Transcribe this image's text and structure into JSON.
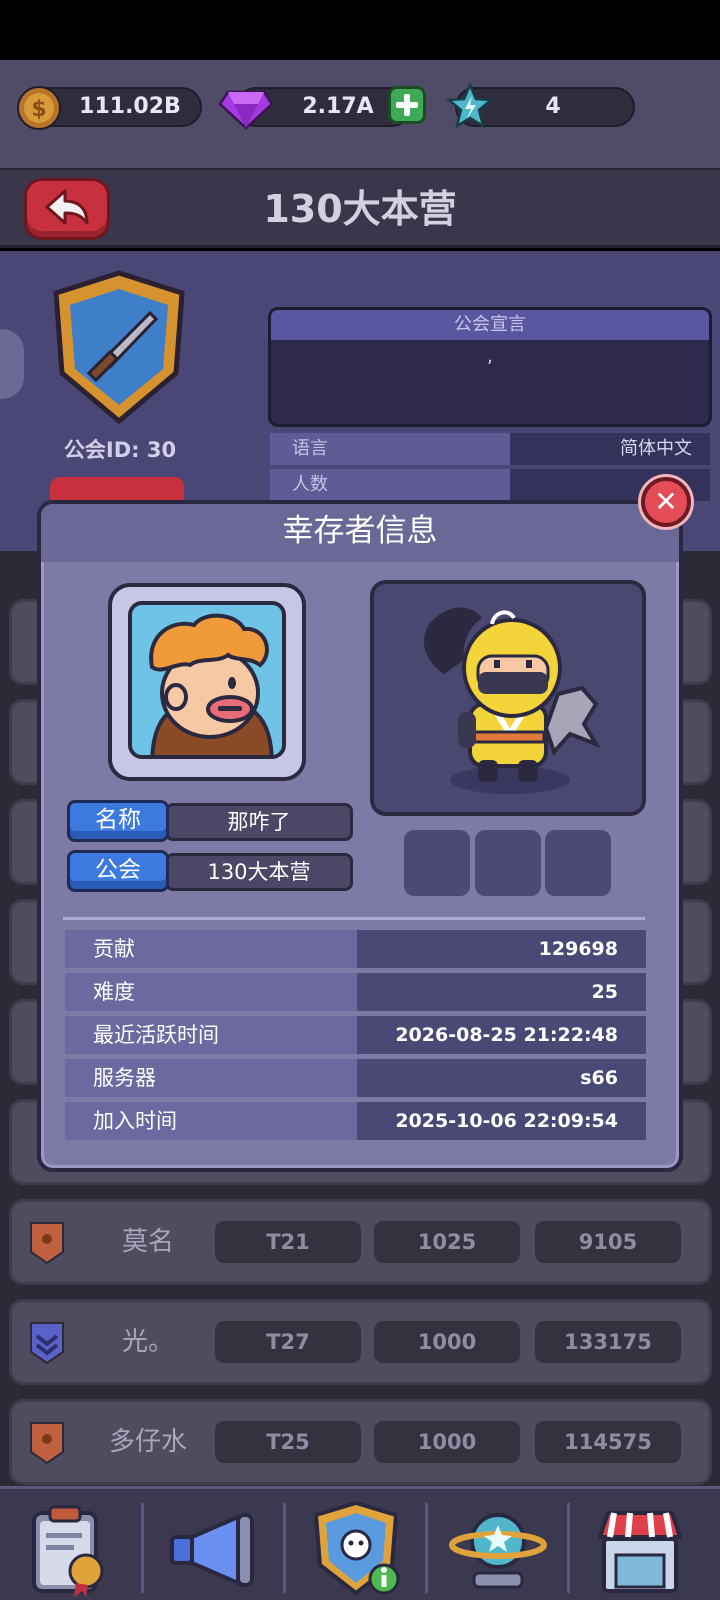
{
  "currency": {
    "gold": "111.02B",
    "gems": "2.17A",
    "energy": "4"
  },
  "header": {
    "title": "130大本营"
  },
  "guild": {
    "id_label": "公会ID: 30",
    "manifesto_title": "公会宣言",
    "manifesto_text": ",",
    "info": [
      {
        "key": "语言",
        "value": "简体中文"
      },
      {
        "key": "人数",
        "value": ""
      }
    ]
  },
  "members": [
    {
      "name": "莫名",
      "tier": "T21",
      "difficulty": "1025",
      "contribution": "9105",
      "rank_color": "#c0603f"
    },
    {
      "name": "光。",
      "tier": "T27",
      "difficulty": "1000",
      "contribution": "133175",
      "rank_color": "#5a62c8"
    },
    {
      "name": "多仔水",
      "tier": "T25",
      "difficulty": "1000",
      "contribution": "114575",
      "rank_color": "#c0603f"
    }
  ],
  "modal": {
    "title": "幸存者信息",
    "name_label": "名称",
    "name_value": "那咋了",
    "guild_label": "公会",
    "guild_value": "130大本营",
    "stats": [
      {
        "key": "贡献",
        "value": "129698"
      },
      {
        "key": "难度",
        "value": "25"
      },
      {
        "key": "最近活跃时间",
        "value": "2026-08-25 21:22:48"
      },
      {
        "key": "服务器",
        "value": "s66"
      },
      {
        "key": "加入时间",
        "value": "2025-10-06 22:09:54"
      }
    ]
  },
  "icons": {
    "gold": "gold-coin-icon",
    "gem": "purple-gem-icon",
    "add": "plus-icon",
    "energy": "energy-star-icon",
    "back": "back-arrow-icon",
    "close": "close-icon"
  },
  "nav": [
    {
      "icon": "clipboard-medal-icon"
    },
    {
      "icon": "megaphone-icon"
    },
    {
      "icon": "guild-info-icon"
    },
    {
      "icon": "planet-icon"
    },
    {
      "icon": "shop-icon"
    }
  ]
}
